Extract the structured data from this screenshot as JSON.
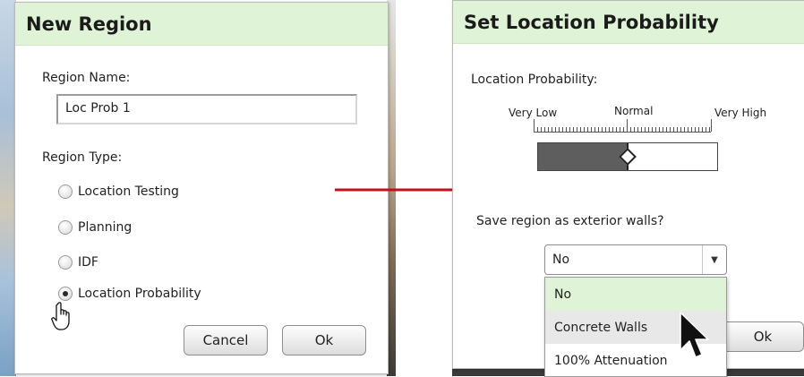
{
  "new_region": {
    "title": "New Region",
    "name_label": "Region Name:",
    "name_value": "Loc Prob 1",
    "type_label": "Region Type:",
    "types": [
      {
        "label": "Location Testing",
        "selected": false
      },
      {
        "label": "Planning",
        "selected": false
      },
      {
        "label": "IDF",
        "selected": false
      },
      {
        "label": "Location Probability",
        "selected": true
      }
    ],
    "cancel_label": "Cancel",
    "ok_label": "Ok"
  },
  "set_probability": {
    "title": "Set Location Probability",
    "probability_label": "Location Probability:",
    "scale": {
      "low_label": "Very Low",
      "mid_label": "Normal",
      "high_label": "Very High",
      "value_fraction": 0.5
    },
    "exterior_label": "Save region as exterior walls?",
    "select_value": "No",
    "options": [
      "No",
      "Concrete Walls",
      "100% Attenuation"
    ],
    "selected_option": "No",
    "hovered_option": "Concrete Walls",
    "ok_label": "Ok"
  },
  "colors": {
    "header_bg": "#dff3d6",
    "arrow": "#c0121b",
    "slider_fill": "#5e5e5e"
  },
  "icons": {
    "flow_arrow": "arrow-right-icon",
    "hand_cursor": "hand-pointer-icon",
    "arrow_cursor": "mouse-pointer-icon",
    "dropdown_caret": "chevron-down-icon"
  }
}
